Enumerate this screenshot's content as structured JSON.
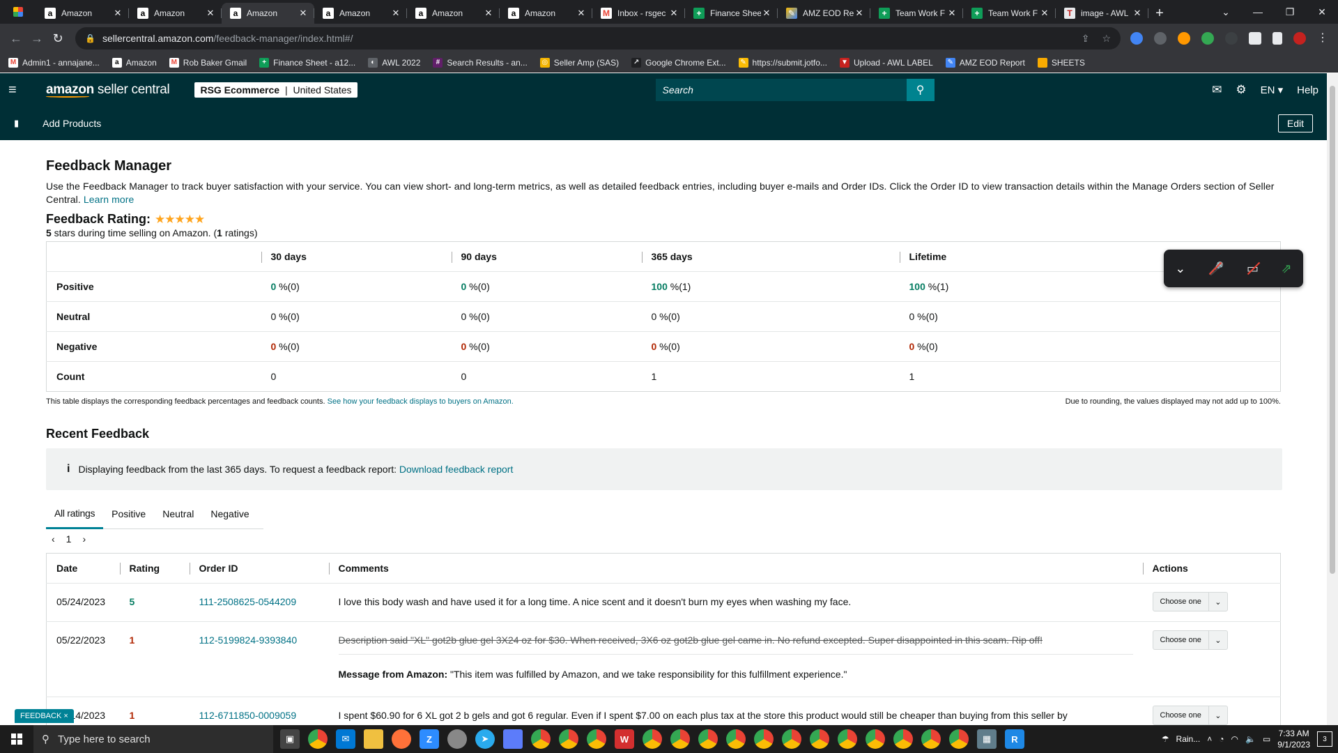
{
  "browser": {
    "tabs": [
      {
        "title": "Amazon",
        "favicon": "amazon-icon",
        "active": false
      },
      {
        "title": "Amazon",
        "favicon": "amazon-icon",
        "active": false
      },
      {
        "title": "Amazon",
        "favicon": "amazon-icon",
        "active": true
      },
      {
        "title": "Amazon",
        "favicon": "amazon-icon",
        "active": false
      },
      {
        "title": "Amazon",
        "favicon": "amazon-icon",
        "active": false
      },
      {
        "title": "Amazon",
        "favicon": "amazon-icon",
        "active": false
      },
      {
        "title": "Inbox - rsgec",
        "favicon": "gmail-icon",
        "active": false
      },
      {
        "title": "Finance Shee",
        "favicon": "sheets-icon",
        "active": false
      },
      {
        "title": "AMZ EOD Re",
        "favicon": "eod-icon",
        "active": false
      },
      {
        "title": "Team Work F",
        "favicon": "sheets-icon",
        "active": false
      },
      {
        "title": "Team Work F",
        "favicon": "sheets-icon",
        "active": false
      },
      {
        "title": "image - AWL",
        "favicon": "image-icon",
        "active": false
      }
    ],
    "url_host": "sellercentral.amazon.com",
    "url_path": "/feedback-manager/index.html#/",
    "bookmarks": [
      {
        "label": "Admin1 - annajane...",
        "icon": "gmail-icon"
      },
      {
        "label": "Amazon",
        "icon": "amazon-icon"
      },
      {
        "label": "Rob Baker Gmail",
        "icon": "gmail-icon"
      },
      {
        "label": "Finance Sheet - a12...",
        "icon": "sheets-icon"
      },
      {
        "label": "AWL 2022",
        "icon": "globe-icon"
      },
      {
        "label": "Search Results - an...",
        "icon": "slack-icon"
      },
      {
        "label": "Seller Amp (SAS)",
        "icon": "selleramp-icon"
      },
      {
        "label": "Google Chrome Ext...",
        "icon": "extension-icon"
      },
      {
        "label": "https://submit.jotfo...",
        "icon": "jotform-icon"
      },
      {
        "label": "Upload - AWL LABEL",
        "icon": "upload-icon"
      },
      {
        "label": "AMZ EOD Report",
        "icon": "eod-icon"
      },
      {
        "label": "SHEETS",
        "icon": "folder-icon"
      }
    ]
  },
  "header": {
    "logo_bold": "amazon",
    "logo_rest": " seller central",
    "store_name": "RSG Ecommerce",
    "store_sep": "|",
    "store_region": "United States",
    "search_placeholder": "Search",
    "language": "EN",
    "help": "Help"
  },
  "subnav": {
    "link": "Add Products",
    "edit": "Edit"
  },
  "page": {
    "title": "Feedback Manager",
    "intro": "Use the Feedback Manager to track buyer satisfaction with your service. You can view short- and long-term metrics, as well as detailed feedback entries, including buyer e-mails and Order IDs. Click the Order ID to view transaction details within the Manage Orders section of Seller Central.",
    "learn_more": "Learn more",
    "rating_label": "Feedback Rating:",
    "stars": "★★★★★",
    "rating_stars_count": "5",
    "rating_sub_mid": " stars during time selling on Amazon. (",
    "rating_count": "1",
    "rating_sub_end": " ratings)"
  },
  "feedback_table": {
    "headers": [
      "",
      "30 days",
      "90 days",
      "365 days",
      "Lifetime"
    ],
    "rows": [
      {
        "label": "Positive",
        "cells": [
          [
            "0",
            " %(0)"
          ],
          [
            "0",
            " %(0)"
          ],
          [
            "100",
            " %(1)"
          ],
          [
            "100",
            " %(1)"
          ]
        ]
      },
      {
        "label": "Neutral",
        "cells": [
          [
            "0",
            " %(0)"
          ],
          [
            "0",
            " %(0)"
          ],
          [
            "0",
            " %(0)"
          ],
          [
            "0",
            " %(0)"
          ]
        ]
      },
      {
        "label": "Negative",
        "cells": [
          [
            "0",
            " %(0)"
          ],
          [
            "0",
            " %(0)"
          ],
          [
            "0",
            " %(0)"
          ],
          [
            "0",
            " %(0)"
          ]
        ]
      },
      {
        "label": "Count",
        "cells": [
          [
            "0",
            ""
          ],
          [
            "0",
            ""
          ],
          [
            "1",
            ""
          ],
          [
            "1",
            ""
          ]
        ]
      }
    ],
    "note_left": "This table displays the corresponding feedback percentages and feedback counts.",
    "note_link": "See how your feedback displays to buyers on Amazon.",
    "note_right": "Due to rounding, the values displayed may not add up to 100%."
  },
  "recent": {
    "title": "Recent Feedback",
    "info_icon": "i",
    "info_text": "Displaying feedback from the last 365 days. To request a feedback report:",
    "info_link": "Download feedback report",
    "tabs": [
      "All ratings",
      "Positive",
      "Neutral",
      "Negative"
    ],
    "page": "1",
    "headers": [
      "Date",
      "Rating",
      "Order ID",
      "Comments",
      "Actions"
    ],
    "rows": [
      {
        "date": "05/24/2023",
        "rating": "5",
        "order": "111-2508625-0544209",
        "comment": "I love this body wash and have used it for a long time. A nice scent and it doesn't burn my eyes when washing my face.",
        "action": "Choose one"
      },
      {
        "date": "05/22/2023",
        "rating": "1",
        "order": "112-5199824-9393840",
        "comment": "Description said \"XL\" got2b glue gel 3X24 oz for $30. When received, 3X6 oz got2b glue gel came in. No refund excepted. Super disappointed in this scam. Rip off!",
        "amazon_label": "Message from Amazon:",
        "amazon_msg": " \"This item was fulfilled by Amazon, and we take responsibility for this fulfillment experience.\"",
        "action": "Choose one"
      },
      {
        "date": "05/14/2023",
        "rating": "1",
        "order": "112-6711850-0009059",
        "comment": "I spent $60.90 for 6 XL got 2 b gels and got 6 regular. Even if I spent $7.00 on each plus tax at the store this product would still be cheaper than buying from this seller by",
        "action": "Choose one"
      }
    ]
  },
  "overlay": {
    "feedback_tab": "FEEDBACK",
    "feedback_close": "×"
  },
  "taskbar": {
    "search_placeholder": "Type here to search",
    "weather": "Rain...",
    "time": "7:33 AM",
    "date": "9/1/2023",
    "notifications": "3"
  },
  "colors": {
    "header_bg": "#002f36",
    "accent": "#008296",
    "positive": "#067d62",
    "negative": "#b12704",
    "star": "#ffa41c"
  }
}
